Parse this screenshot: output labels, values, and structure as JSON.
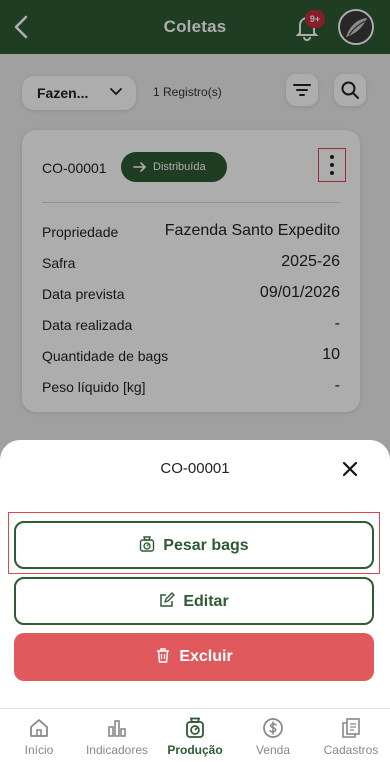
{
  "header": {
    "title": "Coletas",
    "notification_badge": "9+"
  },
  "filters": {
    "farm_select": "Fazen...",
    "record_count": "1 Registro(s)"
  },
  "card": {
    "code": "CO-00001",
    "status": "Distribuída",
    "fields": [
      {
        "label": "Propriedade",
        "value": "Fazenda Santo Expedito"
      },
      {
        "label": "Safra",
        "value": "2025-26"
      },
      {
        "label": "Data prevista",
        "value": "09/01/2026"
      },
      {
        "label": "Data realizada",
        "value": "-"
      },
      {
        "label": "Quantidade de bags",
        "value": "10"
      },
      {
        "label": "Peso líquido [kg]",
        "value": "-"
      }
    ]
  },
  "sheet": {
    "title": "CO-00001",
    "actions": {
      "weigh": "Pesar bags",
      "edit": "Editar",
      "delete": "Excluir"
    }
  },
  "nav": {
    "items": [
      {
        "label": "Início",
        "icon": "home-icon"
      },
      {
        "label": "Indicadores",
        "icon": "bar-chart-icon"
      },
      {
        "label": "Produção",
        "icon": "scale-icon"
      },
      {
        "label": "Venda",
        "icon": "dollar-circle-icon"
      },
      {
        "label": "Cadastros",
        "icon": "documents-icon"
      }
    ],
    "active": "Produção"
  },
  "colors": {
    "primary": "#2e5a34",
    "danger": "#e05a5d",
    "highlight": "#e0454f",
    "badge": "#c62f3a"
  }
}
